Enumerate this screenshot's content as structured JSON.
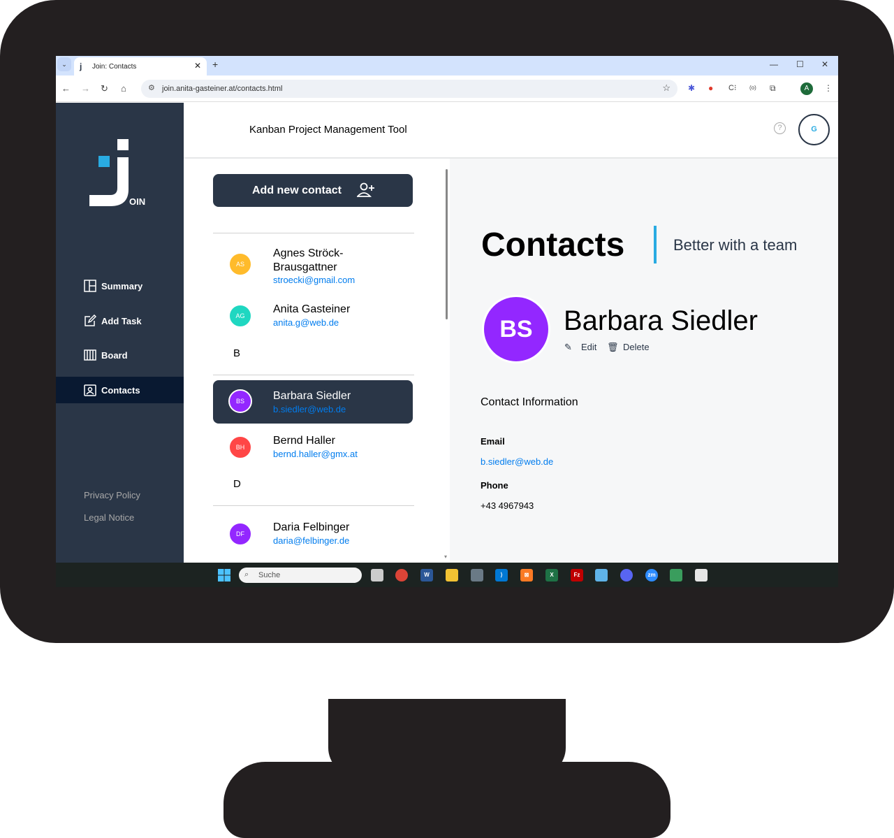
{
  "browser": {
    "tab_title": "Join: Contacts",
    "tab_favicon": "j",
    "url": "join.anita-gasteiner.at/contacts.html",
    "profile_initial": "A"
  },
  "sidebar": {
    "logo_text": "OIN",
    "items": [
      {
        "label": "Summary",
        "icon": "summary-icon"
      },
      {
        "label": "Add Task",
        "icon": "add-task-icon"
      },
      {
        "label": "Board",
        "icon": "board-icon"
      },
      {
        "label": "Contacts",
        "icon": "contacts-icon",
        "active": true
      }
    ],
    "footer": {
      "privacy": "Privacy Policy",
      "legal": "Legal Notice"
    }
  },
  "header": {
    "title": "Kanban Project Management Tool",
    "help": "?",
    "user_initial": "G"
  },
  "contacts": {
    "add_button": "Add new contact",
    "groups": [
      {
        "letter": "",
        "items": [
          {
            "initials": "AS",
            "name": "Agnes Ströck-Brausgattner",
            "email": "stroecki@gmail.com",
            "color": "#ffbb2b"
          },
          {
            "initials": "AG",
            "name": "Anita Gasteiner",
            "email": "anita.g@web.de",
            "color": "#1fd7c1"
          }
        ]
      },
      {
        "letter": "B",
        "items": [
          {
            "initials": "BS",
            "name": "Barbara Siedler",
            "email": "b.siedler@web.de",
            "color": "#9327ff",
            "selected": true
          },
          {
            "initials": "BH",
            "name": "Bernd Haller",
            "email": "bernd.haller@gmx.at",
            "color": "#ff4646"
          }
        ]
      },
      {
        "letter": "D",
        "items": [
          {
            "initials": "DF",
            "name": "Daria Felbinger",
            "email": "daria@felbinger.de",
            "color": "#9327ff"
          }
        ]
      }
    ]
  },
  "detail": {
    "title": "Contacts",
    "subtitle": "Better with a team",
    "initials": "BS",
    "name": "Barbara Siedler",
    "edit": "Edit",
    "delete": "Delete",
    "info_heading": "Contact Information",
    "email_label": "Email",
    "email": "b.siedler@web.de",
    "phone_label": "Phone",
    "phone": "+43 4967943",
    "accent": "#29abe2"
  },
  "taskbar": {
    "search_placeholder": "Suche"
  }
}
